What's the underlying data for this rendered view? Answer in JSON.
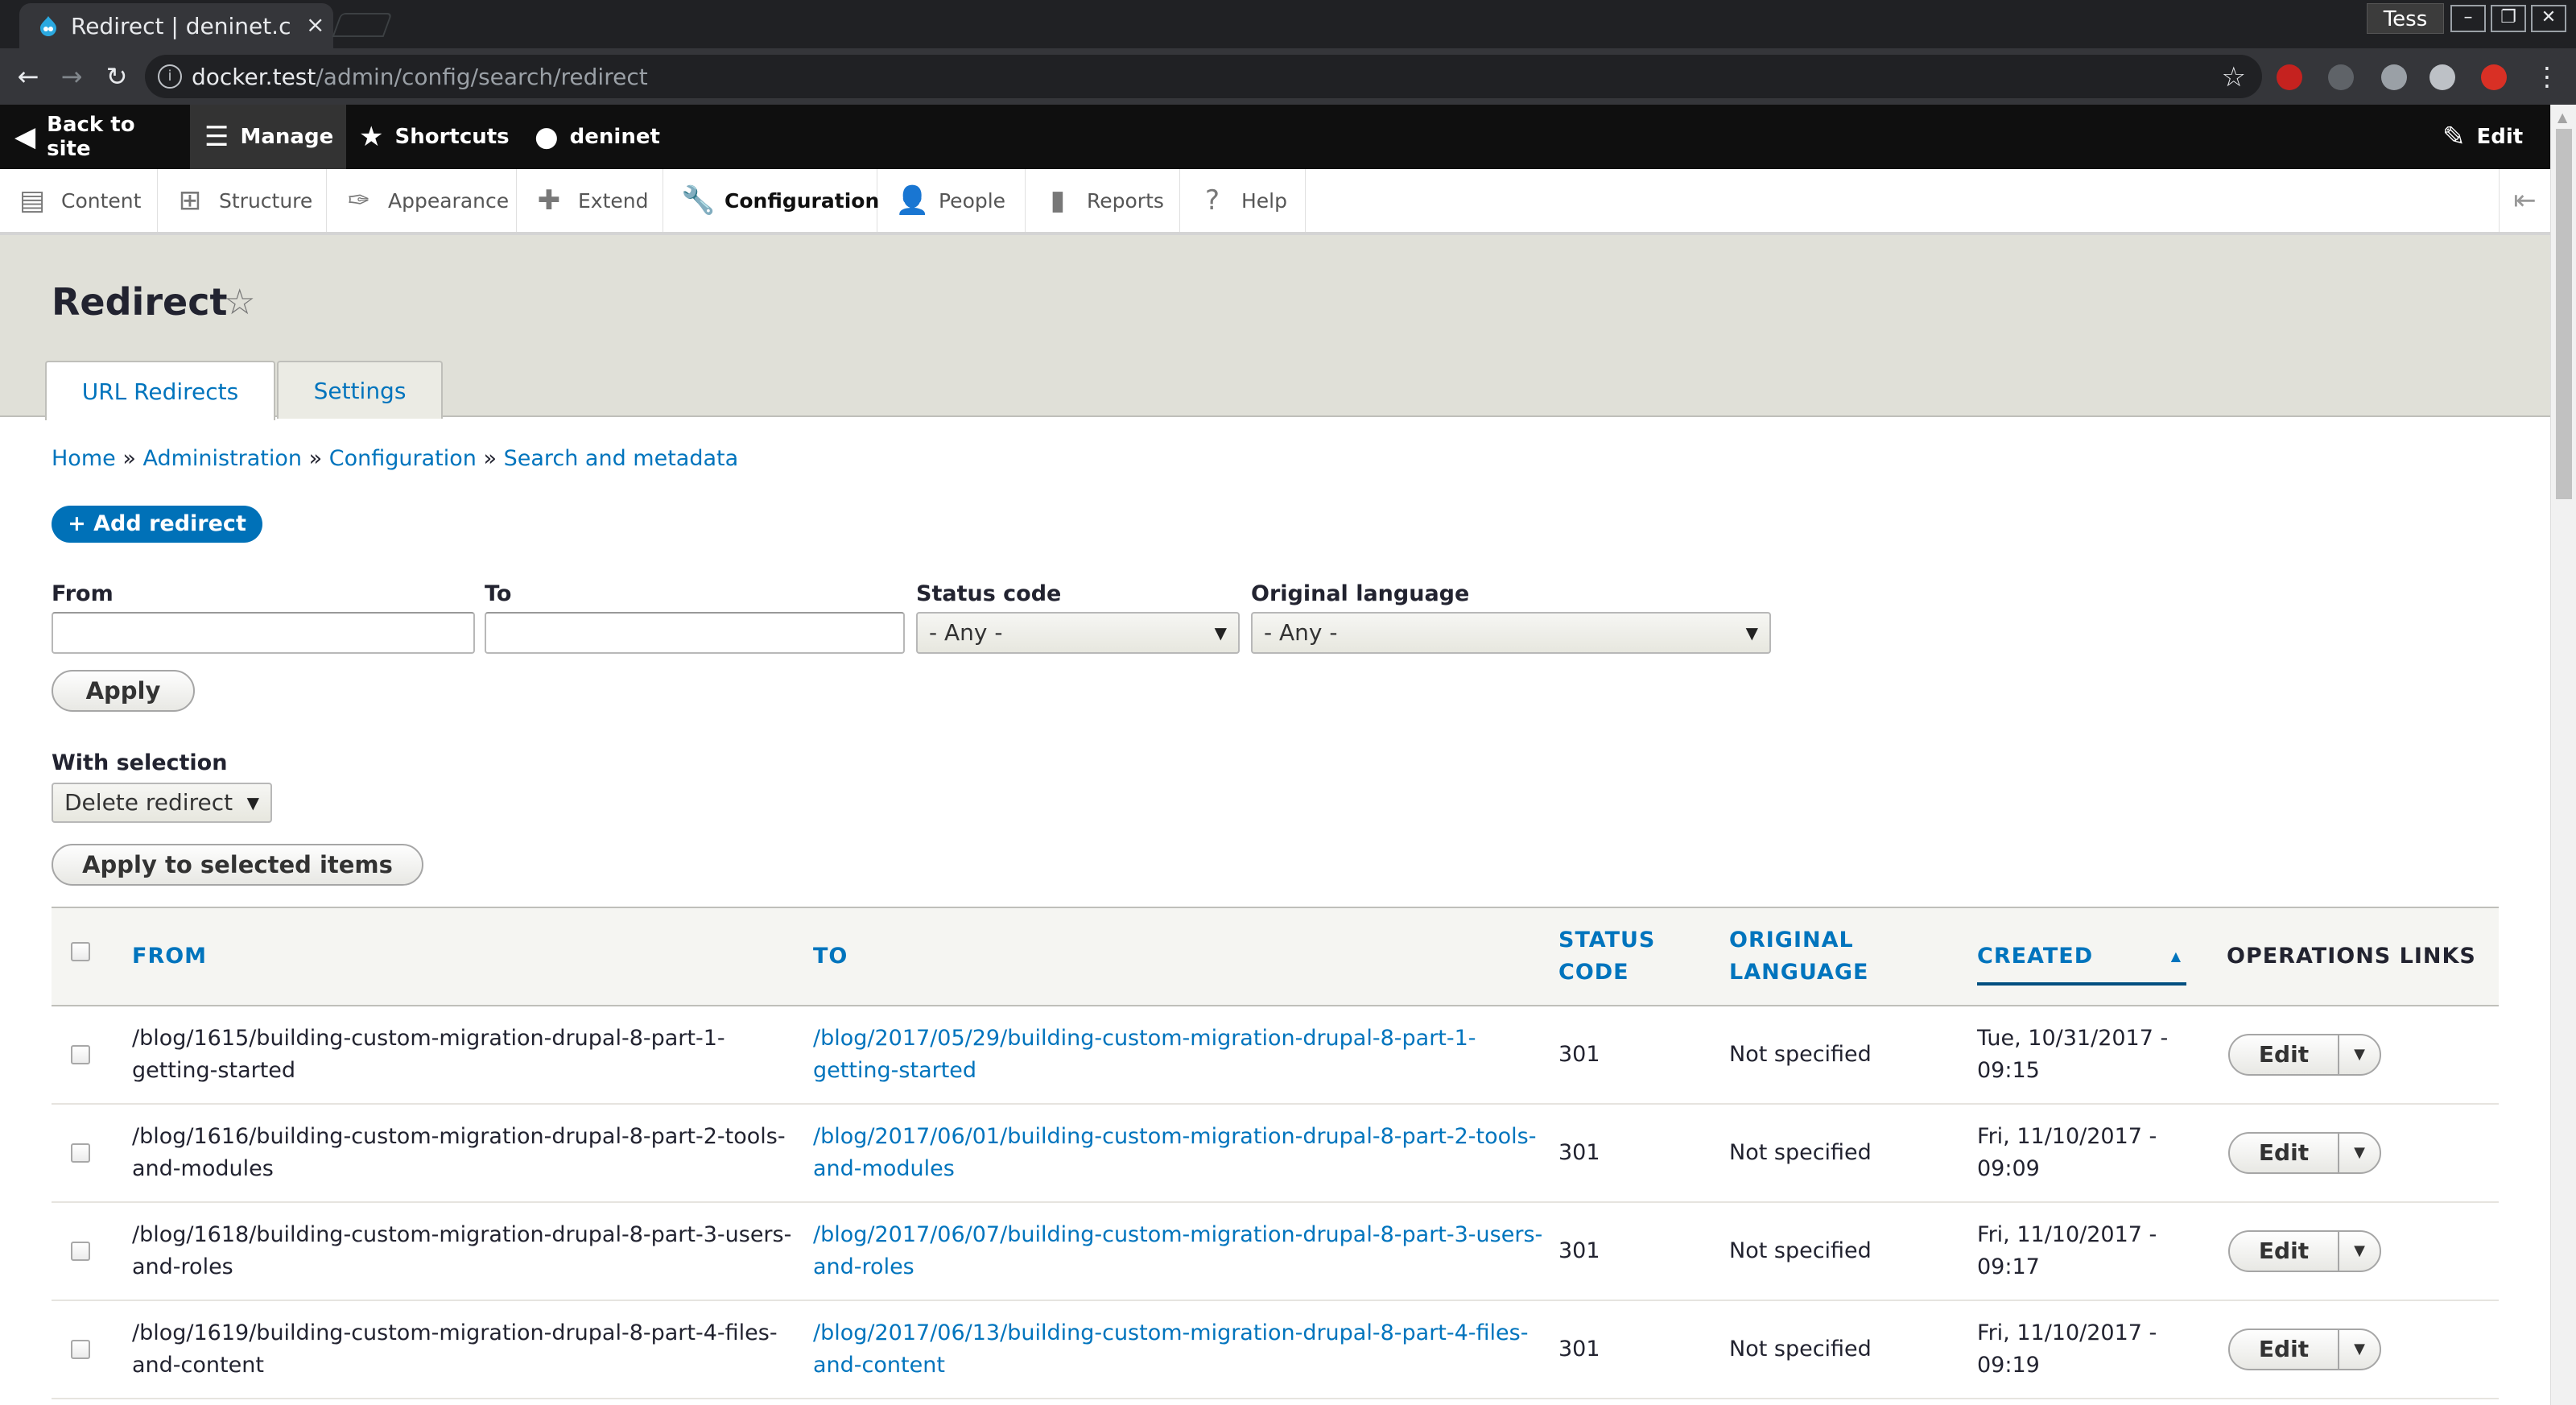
{
  "browser": {
    "tab_title": "Redirect | deninet.c",
    "tab_close": "×",
    "profile": "Tess",
    "url_host": "docker.test",
    "url_path": "/admin/config/search/redirect",
    "window_controls": [
      "–",
      "❐",
      "✕"
    ]
  },
  "toolbar": {
    "back_to_site": "Back to site",
    "manage": "Manage",
    "shortcuts": "Shortcuts",
    "user": "deninet",
    "edit": "Edit"
  },
  "tray": {
    "items": [
      "Content",
      "Structure",
      "Appearance",
      "Extend",
      "Configuration",
      "People",
      "Reports",
      "Help"
    ]
  },
  "page": {
    "title": "Redirect",
    "tabs": [
      "URL Redirects",
      "Settings"
    ]
  },
  "breadcrumb": [
    "Home",
    "Administration",
    "Configuration",
    "Search and metadata"
  ],
  "breadcrumb_sep": "»",
  "actions": {
    "add_redirect": "+ Add redirect"
  },
  "filters": {
    "from_label": "From",
    "from_value": "",
    "to_label": "To",
    "to_value": "",
    "status_label": "Status code",
    "status_value": "- Any -",
    "language_label": "Original language",
    "language_value": "- Any -",
    "apply": "Apply"
  },
  "bulk": {
    "label": "With selection",
    "value": "Delete redirect",
    "apply": "Apply to selected items"
  },
  "table": {
    "headers": {
      "from": "FROM",
      "to": "TO",
      "status_1": "STATUS",
      "status_2": "CODE",
      "lang_1": "ORIGINAL",
      "lang_2": "LANGUAGE",
      "created": "CREATED",
      "ops": "OPERATIONS LINKS"
    },
    "rows": [
      {
        "from_1": "/blog/1615/building-custom-migration-drupal-8-part-1-",
        "from_2": "getting-started",
        "to_1": "/blog/2017/05/29/building-custom-migration-drupal-8-part-1-",
        "to_2": "getting-started",
        "status": "301",
        "language": "Not specified",
        "created_1": "Tue, 10/31/2017 -",
        "created_2": "09:15",
        "op": "Edit"
      },
      {
        "from_1": "/blog/1616/building-custom-migration-drupal-8-part-2-tools-",
        "from_2": "and-modules",
        "to_1": "/blog/2017/06/01/building-custom-migration-drupal-8-part-2-tools-",
        "to_2": "and-modules",
        "status": "301",
        "language": "Not specified",
        "created_1": "Fri, 11/10/2017 -",
        "created_2": "09:09",
        "op": "Edit"
      },
      {
        "from_1": "/blog/1618/building-custom-migration-drupal-8-part-3-users-",
        "from_2": "and-roles",
        "to_1": "/blog/2017/06/07/building-custom-migration-drupal-8-part-3-users-",
        "to_2": "and-roles",
        "status": "301",
        "language": "Not specified",
        "created_1": "Fri, 11/10/2017 -",
        "created_2": "09:17",
        "op": "Edit"
      },
      {
        "from_1": "/blog/1619/building-custom-migration-drupal-8-part-4-files-",
        "from_2": "and-content",
        "to_1": "/blog/2017/06/13/building-custom-migration-drupal-8-part-4-files-",
        "to_2": "and-content",
        "status": "301",
        "language": "Not specified",
        "created_1": "Fri, 11/10/2017 -",
        "created_2": "09:19",
        "op": "Edit"
      }
    ]
  },
  "colors": {
    "link": "#0074bd",
    "primary_button": "#0071b8",
    "toolbar": "#0f0f0f",
    "header_bg": "#e0e0d8"
  },
  "icons": [
    "drupal-favicon",
    "back-arrow-icon",
    "forward-arrow-icon",
    "reload-icon",
    "info-icon",
    "bookmark-star-icon",
    "back-to-site-icon",
    "hamburger-icon",
    "shortcuts-star-icon",
    "user-icon",
    "pencil-icon",
    "content-icon",
    "structure-icon",
    "appearance-icon",
    "extend-icon",
    "configuration-icon",
    "people-icon",
    "reports-icon",
    "help-icon",
    "collapse-tray-icon",
    "favorite-star-icon",
    "chevron-down-icon"
  ]
}
